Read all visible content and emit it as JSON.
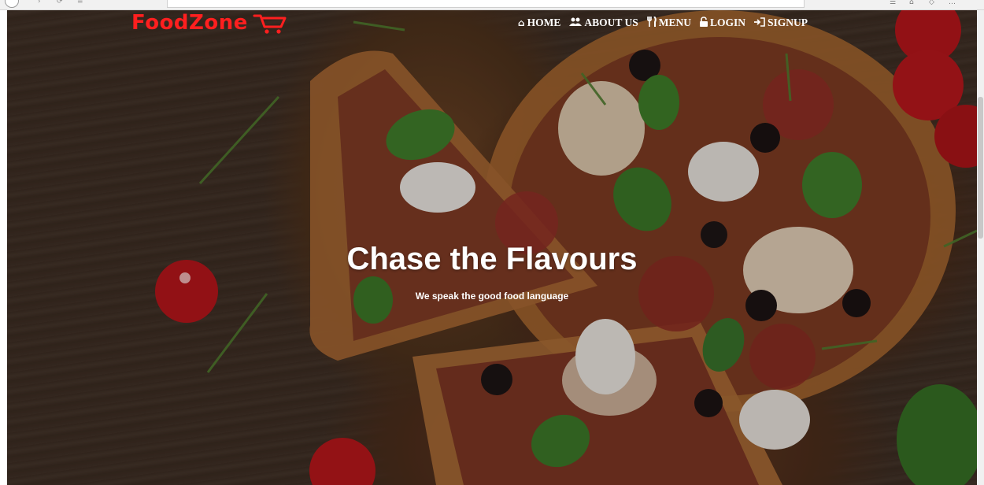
{
  "brand": {
    "name": "FoodZone",
    "logo_color": "#ff1f1f"
  },
  "nav": {
    "items": [
      {
        "label": "HOME",
        "icon": "home-icon"
      },
      {
        "label": "ABOUT US",
        "icon": "users-icon"
      },
      {
        "label": "MENU",
        "icon": "cutlery-icon"
      },
      {
        "label": "LOGIN",
        "icon": "lock-icon"
      },
      {
        "label": "SIGNUP",
        "icon": "sign-in-icon"
      }
    ]
  },
  "hero": {
    "title": "Chase the Flavours",
    "subtitle": "We speak the good food language",
    "background": "pizza-photo"
  },
  "colors": {
    "nav_text": "#ffffff",
    "hero_text": "#ffffff"
  }
}
